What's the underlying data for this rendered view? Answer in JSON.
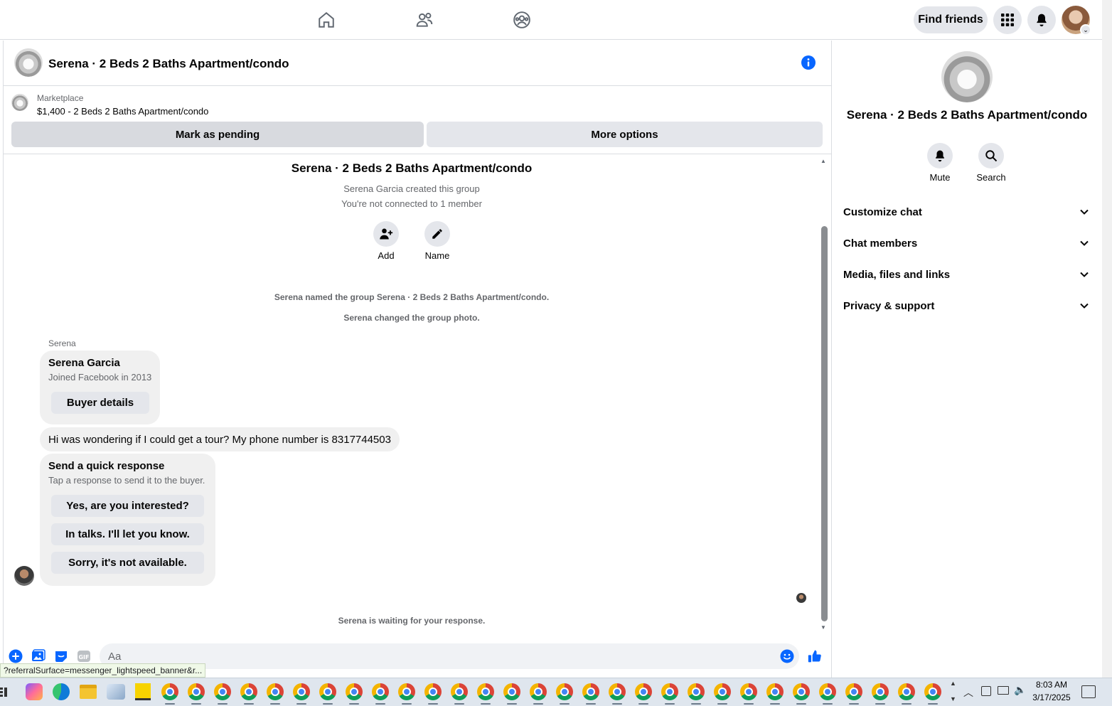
{
  "nav": {
    "find_friends": "Find friends"
  },
  "chat": {
    "title": "Serena · 2 Beds 2 Baths Apartment/condo",
    "marketplace_label": "Marketplace",
    "listing": "$1,400 - 2 Beds 2 Baths Apartment/condo",
    "mark_pending": "Mark as pending",
    "more_options": "More options"
  },
  "thread": {
    "group_title": "Serena · 2 Beds 2 Baths Apartment/condo",
    "created": "Serena Garcia created this group",
    "not_connected": "You're not connected to 1 member",
    "add_label": "Add",
    "name_label": "Name",
    "named_note": "Serena named the group Serena · 2 Beds 2 Baths Apartment/condo.",
    "photo_note": "Serena changed the group photo.",
    "sender_short": "Serena",
    "profile_name": "Serena Garcia",
    "profile_joined": "Joined Facebook in 2013",
    "buyer_details": "Buyer details",
    "message": "Hi was wondering if I could get a tour? My phone number is 8317744503",
    "quick_title": "Send a quick response",
    "quick_sub": "Tap a response to send it to the buyer.",
    "quick_replies": [
      "Yes, are you interested?",
      "In talks. I'll let you know.",
      "Sorry, it's not available."
    ],
    "waiting": "Serena is waiting for your response."
  },
  "composer": {
    "placeholder": "Aa",
    "status_url": "?referralSurface=messenger_lightspeed_banner&r..."
  },
  "panel": {
    "title": "Serena · 2 Beds 2 Baths Apartment/condo",
    "mute": "Mute",
    "search": "Search",
    "sections": [
      "Customize chat",
      "Chat members",
      "Media, files and links",
      "Privacy & support"
    ]
  },
  "taskbar": {
    "time": "8:03 AM",
    "date": "3/17/2025"
  },
  "colors": {
    "accent": "#0866ff",
    "button_gray": "#e4e6eb",
    "bubble_gray": "#f0f0f0",
    "secondary_text": "#65676b"
  }
}
